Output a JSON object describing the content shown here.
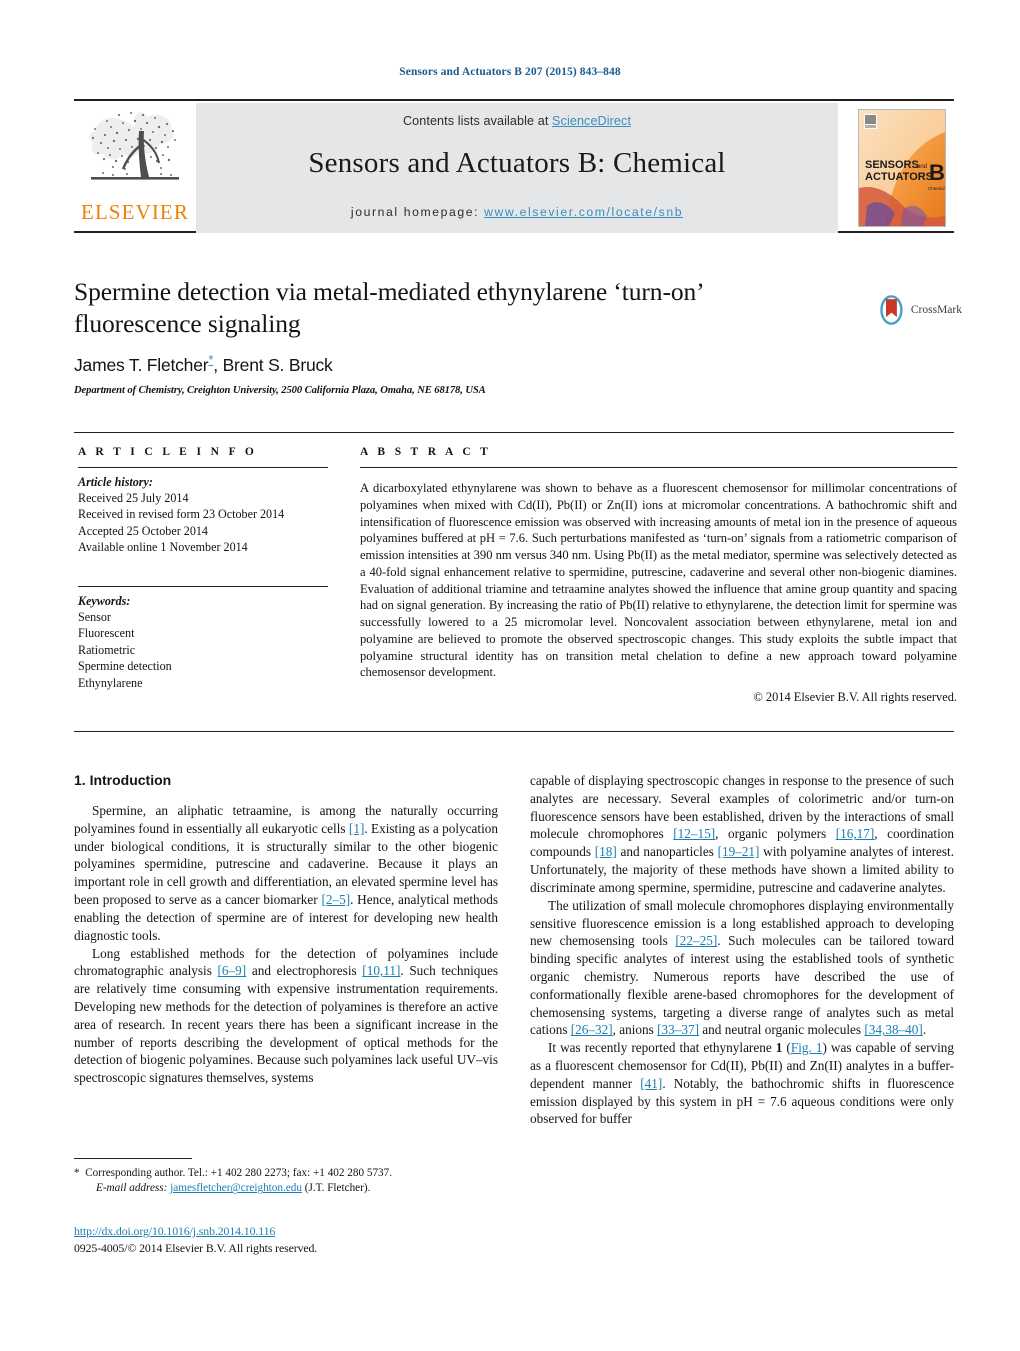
{
  "running_head": "Sensors and Actuators B 207 (2015) 843–848",
  "masthead": {
    "contents_prefix": "Contents lists available at ",
    "sciencedirect": "ScienceDirect",
    "journal_title": "Sensors and Actuators B: Chemical",
    "homepage_prefix": "journal homepage: ",
    "homepage_url": "www.elsevier.com/locate/snb",
    "publisher_wordmark": "ELSEVIER",
    "publisher_logo_icon": "elsevier-tree-icon",
    "cover_line1": "SENSORS",
    "cover_and": "and",
    "cover_line2": "ACTUATORS",
    "cover_letter": "B",
    "cover_sub": "Chemical",
    "accent_link_color": "#3c8dbc",
    "wordmark_color": "#f08000"
  },
  "article": {
    "title": "Spermine detection via metal-mediated ethynylarene ‘turn-on’ fluorescence signaling",
    "authors": "James T. Fletcher",
    "author_star": "*",
    "authors_rest": ", Brent S. Bruck",
    "affiliation": "Department of Chemistry, Creighton University, 2500 California Plaza, Omaha, NE 68178, USA",
    "crossmark_label": "CrossMark",
    "crossmark_icon": "crossmark-logo-icon"
  },
  "article_info": {
    "heading": "A R T I C L E   I N F O",
    "history_label": "Article history:",
    "history": [
      "Received 25 July 2014",
      "Received in revised form 23 October 2014",
      "Accepted 25 October 2014",
      "Available online 1 November 2014"
    ],
    "keywords_label": "Keywords:",
    "keywords": [
      "Sensor",
      "Fluorescent",
      "Ratiometric",
      "Spermine detection",
      "Ethynylarene"
    ]
  },
  "abstract": {
    "heading": "A B S T R A C T",
    "text": "A dicarboxylated ethynylarene was shown to behave as a fluorescent chemosensor for millimolar concentrations of polyamines when mixed with Cd(II), Pb(II) or Zn(II) ions at micromolar concentrations. A bathochromic shift and intensification of fluorescence emission was observed with increasing amounts of metal ion in the presence of aqueous polyamines buffered at pH = 7.6. Such perturbations manifested as ‘turn-on’ signals from a ratiometric comparison of emission intensities at 390 nm versus 340 nm. Using Pb(II) as the metal mediator, spermine was selectively detected as a 40-fold signal enhancement relative to spermidine, putrescine, cadaverine and several other non-biogenic diamines. Evaluation of additional triamine and tetraamine analytes showed the influence that amine group quantity and spacing had on signal generation. By increasing the ratio of Pb(II) relative to ethynylarene, the detection limit for spermine was successfully lowered to a 25 micromolar level. Noncovalent association between ethynylarene, metal ion and polyamine are believed to promote the observed spectroscopic changes. This study exploits the subtle impact that polyamine structural identity has on transition metal chelation to define a new approach toward polyamine chemosensor development.",
    "copyright": "© 2014 Elsevier B.V. All rights reserved."
  },
  "body": {
    "section_heading": "1.  Introduction",
    "left_p1_a": "Spermine, an aliphatic tetraamine, is among the naturally occurring polyamines found in essentially all eukaryotic cells ",
    "left_p1_r1": "[1]",
    "left_p1_b": ". Existing as a polycation under biological conditions, it is structurally similar to the other biogenic polyamines spermidine, putrescine and cadaverine. Because it plays an important role in cell growth and differentiation, an elevated spermine level has been proposed to serve as a cancer biomarker ",
    "left_p1_r2": "[2–5]",
    "left_p1_c": ". Hence, analytical methods enabling the detection of spermine are of interest for developing new health diagnostic tools.",
    "left_p2_a": "Long established methods for the detection of polyamines include chromatographic analysis ",
    "left_p2_r1": "[6–9]",
    "left_p2_b": " and electrophoresis ",
    "left_p2_r2": "[10,11]",
    "left_p2_c": ". Such techniques are relatively time consuming with expensive instrumentation requirements. Developing new methods for the detection of polyamines is therefore an active area of research. In recent years there has been a significant increase in the number of reports describing the development of optical methods for the detection of biogenic polyamines. Because such polyamines lack useful UV–vis spectroscopic signatures themselves, systems",
    "right_p1_a": "capable of displaying spectroscopic changes in response to the presence of such analytes are necessary. Several examples of colorimetric and/or turn-on fluorescence sensors have been established, driven by the interactions of small molecule chromophores ",
    "right_p1_r1": "[12–15]",
    "right_p1_b": ", organic polymers ",
    "right_p1_r2": "[16,17]",
    "right_p1_c": ", coordination compounds ",
    "right_p1_r3": "[18]",
    "right_p1_d": " and nanoparticles ",
    "right_p1_r4": "[19–21]",
    "right_p1_e": " with polyamine analytes of interest. Unfortunately, the majority of these methods have shown a limited ability to discriminate among spermine, spermidine, putrescine and cadaverine analytes.",
    "right_p2_a": "The utilization of small molecule chromophores displaying environmentally sensitive fluorescence emission is a long established approach to developing new chemosensing tools ",
    "right_p2_r1": "[22–25]",
    "right_p2_b": ". Such molecules can be tailored toward binding specific analytes of interest using the established tools of synthetic organic chemistry. Numerous reports have described the use of conformationally flexible arene-based chromophores for the development of chemosensing systems, targeting a diverse range of analytes such as metal cations ",
    "right_p2_r2": "[26–32]",
    "right_p2_c": ", anions ",
    "right_p2_r3": "[33–37]",
    "right_p2_d": " and neutral organic molecules ",
    "right_p2_r4": "[34,38–40]",
    "right_p2_e": ".",
    "right_p3_a": "It was recently reported that ethynylarene ",
    "right_p3_bold": "1",
    "right_p3_b": " (",
    "right_p3_fig": "Fig. 1",
    "right_p3_c": ") was capable of serving as a fluorescent chemosensor for Cd(II), Pb(II) and Zn(II) analytes in a buffer-dependent manner ",
    "right_p3_r1": "[41]",
    "right_p3_d": ". Notably, the bathochromic shifts in fluorescence emission displayed by this system in pH = 7.6 aqueous conditions were only observed for buffer"
  },
  "footnote": {
    "star": "*",
    "corresponding": "Corresponding author. Tel.: +1 402 280 2273; fax: +1 402 280 5737.",
    "email_label": "E-mail address:",
    "email": "jamesfletcher@creighton.edu",
    "email_owner": "(J.T. Fletcher).",
    "doi": "http://dx.doi.org/10.1016/j.snb.2014.10.116",
    "issn": "0925-4005/© 2014 Elsevier B.V. All rights reserved."
  }
}
